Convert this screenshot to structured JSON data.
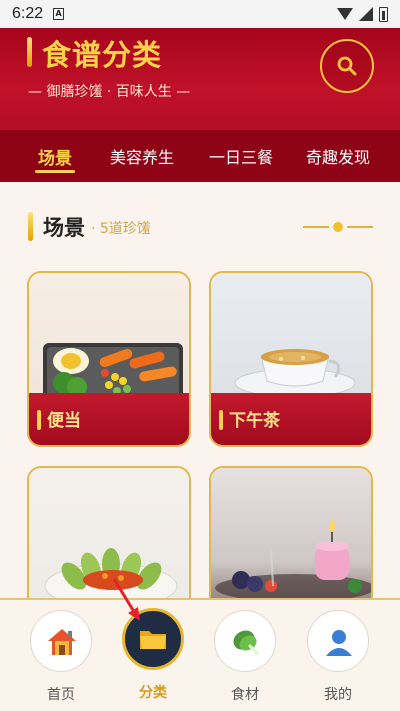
{
  "status_bar": {
    "time": "6:22",
    "sim_icon": "A"
  },
  "header": {
    "title": "食谱分类",
    "subtitle": "— 御膳珍馐 · 百味人生 —",
    "search_icon": "search-icon"
  },
  "tabs": [
    {
      "label": "场景",
      "active": true
    },
    {
      "label": "美容养生",
      "active": false
    },
    {
      "label": "一日三餐",
      "active": false
    },
    {
      "label": "奇趣发现",
      "active": false
    }
  ],
  "section": {
    "title": "场景",
    "count": "· 5道珍馐"
  },
  "cards": [
    {
      "label": "便当",
      "image": "bento-box-image"
    },
    {
      "label": "下午茶",
      "image": "afternoon-tea-image"
    },
    {
      "label": "",
      "image": "vegetable-dish-image"
    },
    {
      "label": "",
      "image": "candle-dinner-image"
    }
  ],
  "bottom_nav": [
    {
      "label": "首页",
      "icon": "house-icon",
      "active": false
    },
    {
      "label": "分类",
      "icon": "folder-icon",
      "active": true
    },
    {
      "label": "食材",
      "icon": "vegetable-icon",
      "active": false
    },
    {
      "label": "我的",
      "icon": "user-icon",
      "active": false
    }
  ],
  "colors": {
    "brand_red": "#b40d24",
    "gold": "#ffd24a",
    "dark_tab": "#8e0416"
  }
}
